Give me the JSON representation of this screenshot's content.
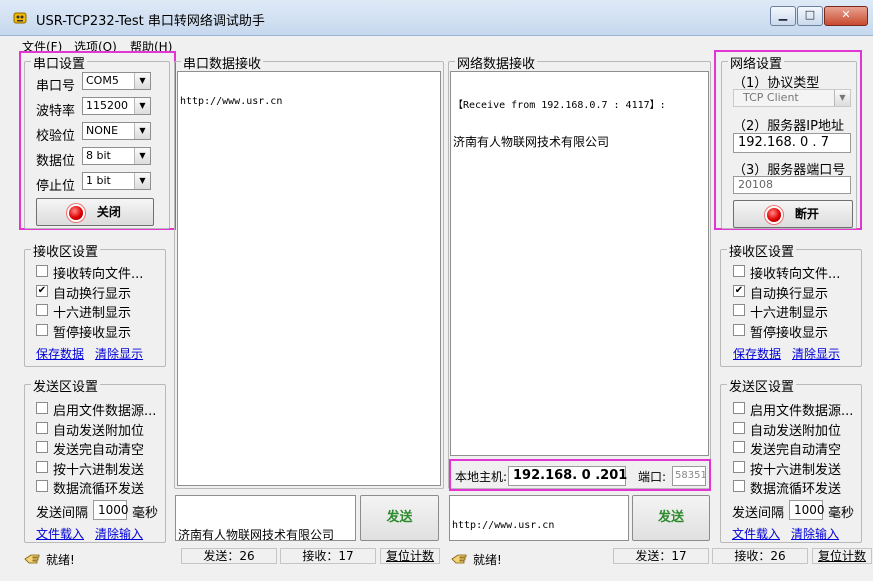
{
  "window": {
    "title": "USR-TCP232-Test 串口转网络调试助手",
    "controls": {
      "minimize": "▁",
      "maximize": "□",
      "close": "✕"
    }
  },
  "menu": [
    "文件(F)",
    "选项(O)",
    "帮助(H)"
  ],
  "serial_settings": {
    "title": "串口设置",
    "port_label": "串口号",
    "port_value": "COM5",
    "baud_label": "波特率",
    "baud_value": "115200",
    "parity_label": "校验位",
    "parity_value": "NONE",
    "databits_label": "数据位",
    "databits_value": "8 bit",
    "stopbits_label": "停止位",
    "stopbits_value": "1 bit",
    "close_button": "关闭"
  },
  "left_receive_settings": {
    "title": "接收区设置",
    "options": [
      {
        "label": "接收转向文件...",
        "checked": false
      },
      {
        "label": "自动换行显示",
        "checked": true
      },
      {
        "label": "十六进制显示",
        "checked": false
      },
      {
        "label": "暂停接收显示",
        "checked": false
      }
    ],
    "save_link": "保存数据",
    "clear_link": "清除显示"
  },
  "left_send_settings": {
    "title": "发送区设置",
    "options": [
      {
        "label": "启用文件数据源...",
        "checked": false
      },
      {
        "label": "自动发送附加位",
        "checked": false
      },
      {
        "label": "发送完自动清空",
        "checked": false
      },
      {
        "label": "按十六进制发送",
        "checked": false
      },
      {
        "label": "数据流循环发送",
        "checked": false
      }
    ],
    "interval_label": "发送间隔",
    "interval_value": "1000",
    "interval_unit": "毫秒",
    "load_link": "文件载入",
    "clear_link": "清除输入"
  },
  "serial_receive": {
    "title": "串口数据接收",
    "content": "http://www.usr.cn"
  },
  "serial_send": {
    "content": "济南有人物联网技术有限公司",
    "send_button": "发送"
  },
  "network_receive": {
    "title": "网络数据接收",
    "line1": "【Receive from 192.168.0.7 : 4117】:",
    "line2": "济南有人物联网技术有限公司"
  },
  "local_host": {
    "label": "本地主机:",
    "ip": "192.168. 0 .201",
    "port_label": "端口:",
    "port_value": "58351"
  },
  "network_send": {
    "content": "http://www.usr.cn",
    "send_button": "发送"
  },
  "network_settings": {
    "title": "网络设置",
    "protocol_label": "（1）协议类型",
    "protocol_value": "TCP Client",
    "server_ip_label": "（2）服务器IP地址",
    "server_ip_value": "192.168. 0 . 7",
    "server_port_label": "（3）服务器端口号",
    "server_port_value": "20108",
    "disconnect_button": "断开"
  },
  "right_receive_settings": {
    "title": "接收区设置",
    "options": [
      {
        "label": "接收转向文件...",
        "checked": false
      },
      {
        "label": "自动换行显示",
        "checked": true
      },
      {
        "label": "十六进制显示",
        "checked": false
      },
      {
        "label": "暂停接收显示",
        "checked": false
      }
    ],
    "save_link": "保存数据",
    "clear_link": "清除显示"
  },
  "right_send_settings": {
    "title": "发送区设置",
    "options": [
      {
        "label": "启用文件数据源...",
        "checked": false
      },
      {
        "label": "自动发送附加位",
        "checked": false
      },
      {
        "label": "发送完自动清空",
        "checked": false
      },
      {
        "label": "按十六进制发送",
        "checked": false
      },
      {
        "label": "数据流循环发送",
        "checked": false
      }
    ],
    "interval_label": "发送间隔",
    "interval_value": "1000",
    "interval_unit": "毫秒",
    "load_link": "文件载入",
    "clear_link": "清除输入"
  },
  "status_left": {
    "ready": "就绪!",
    "sent": "发送：26",
    "received": "接收：17",
    "reset": "复位计数"
  },
  "status_right": {
    "ready": "就绪!",
    "sent": "发送：17",
    "received": "接收：26",
    "reset": "复位计数"
  },
  "colors": {
    "highlight": "#e236d4",
    "send_text": "#2e8b2e",
    "link": "#0000d8",
    "led": "#e00000"
  }
}
